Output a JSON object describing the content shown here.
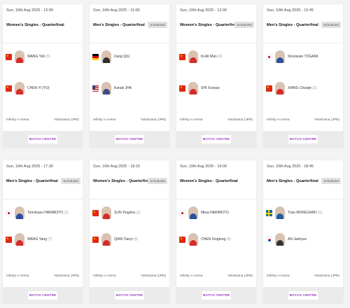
{
  "colors": {
    "accent": "#9b3fc4",
    "badge_bg": "#e2e2e2",
    "footer_bg": "#ebebeb"
  },
  "cards": [
    {
      "date": "Sun, 10th Aug 2025 - 12:00",
      "event": "Women's Singles - Quarterfinal",
      "badge": "",
      "p1": {
        "name": "WANG Yidi",
        "seed": "(3)",
        "flag": "china-flag-icon"
      },
      "p2": {
        "name": "CHEN Yi (YO)",
        "seed": "",
        "flag": "china-flag-icon"
      },
      "venue": "Infinity ∞ Arena",
      "city": "Yokohama (JPN)",
      "button": "MATCH CENTRE"
    },
    {
      "date": "Sun, 10th Aug 2025 - 11:00",
      "event": "Men's Singles - Quarterfinal",
      "badge": "Scheduled",
      "p1": {
        "name": "Dang QIU",
        "seed": "",
        "flag": "germany-flag-icon"
      },
      "p2": {
        "name": "Kanak JHA",
        "seed": "",
        "flag": "usa-flag-icon"
      },
      "venue": "Infinity ∞ Arena",
      "city": "Yokohama (JPN)",
      "button": "MATCH CENTRE"
    },
    {
      "date": "Sun, 10th Aug 2025 - 12:00",
      "event": "Women's Singles - Quarterfinal",
      "badge": "Scheduled",
      "p1": {
        "name": "KUAI Man",
        "seed": "(4)",
        "flag": "china-flag-icon"
      },
      "p2": {
        "name": "SHI Xunyao",
        "seed": "",
        "flag": "china-flag-icon"
      },
      "venue": "Infinity ∞ Arena",
      "city": "Yokohama (JPN)",
      "button": "MATCH CENTRE"
    },
    {
      "date": "Sun, 10th Aug 2025 - 12:45",
      "event": "Men's Singles - Quarterfinal",
      "badge": "Scheduled",
      "p1": {
        "name": "Shunsuke TOGAMI",
        "seed": "",
        "flag": "japan-flag-icon"
      },
      "p2": {
        "name": "XIANG Chaojie",
        "seed": "(2)",
        "flag": "china-flag-icon"
      },
      "venue": "Infinity ∞ Arena",
      "city": "Yokohama (JPN)",
      "button": "MATCH CENTRE"
    },
    {
      "date": "Sun, 10th Aug 2025 - 17:30",
      "event": "Men's Singles - Quarterfinal",
      "badge": "Scheduled",
      "p1": {
        "name": "Tomokazu HARIMOTO",
        "seed": "(1)",
        "flag": "japan-flag-icon"
      },
      "p2": {
        "name": "WANG Yang",
        "seed": "(7)",
        "flag": "china-flag-icon"
      },
      "venue": "Infinity ∞ Arena",
      "city": "Yokohama (JPN)",
      "button": "MATCH CENTRE"
    },
    {
      "date": "Sun, 10th Aug 2025 - 18:15",
      "event": "Women's Singles - Quarterfinal",
      "badge": "Scheduled",
      "p1": {
        "name": "SUN Yingsha",
        "seed": "(1)",
        "flag": "china-flag-icon"
      },
      "p2": {
        "name": "QIAN Tianyi",
        "seed": "(5)",
        "flag": "china-flag-icon"
      },
      "venue": "Infinity ∞ Arena",
      "city": "Yokohama (JPN)",
      "button": "MATCH CENTRE"
    },
    {
      "date": "Sun, 10th Aug 2025 - 19:00",
      "event": "Women's Singles - Quarterfinal",
      "badge": "",
      "p1": {
        "name": "Miwa HARIMOTO",
        "seed": "",
        "flag": "japan-flag-icon"
      },
      "p2": {
        "name": "CHEN Xingtong",
        "seed": "(8)",
        "flag": "china-flag-icon"
      },
      "venue": "Infinity ∞ Arena",
      "city": "Yokohama (JPN)",
      "button": "MATCH CENTRE"
    },
    {
      "date": "Sun, 10th Aug 2025 - 18:45",
      "event": "Men's Singles - Quarterfinal",
      "badge": "Scheduled",
      "p1": {
        "name": "Truls MOREGARD",
        "seed": "(5)",
        "flag": "sweden-flag-icon"
      },
      "p2": {
        "name": "AN Jaehyun",
        "seed": "",
        "flag": "korea-flag-icon"
      },
      "venue": "Infinity ∞ Arena",
      "city": "Yokohama (JPN)",
      "button": "MATCH CENTRE"
    }
  ]
}
